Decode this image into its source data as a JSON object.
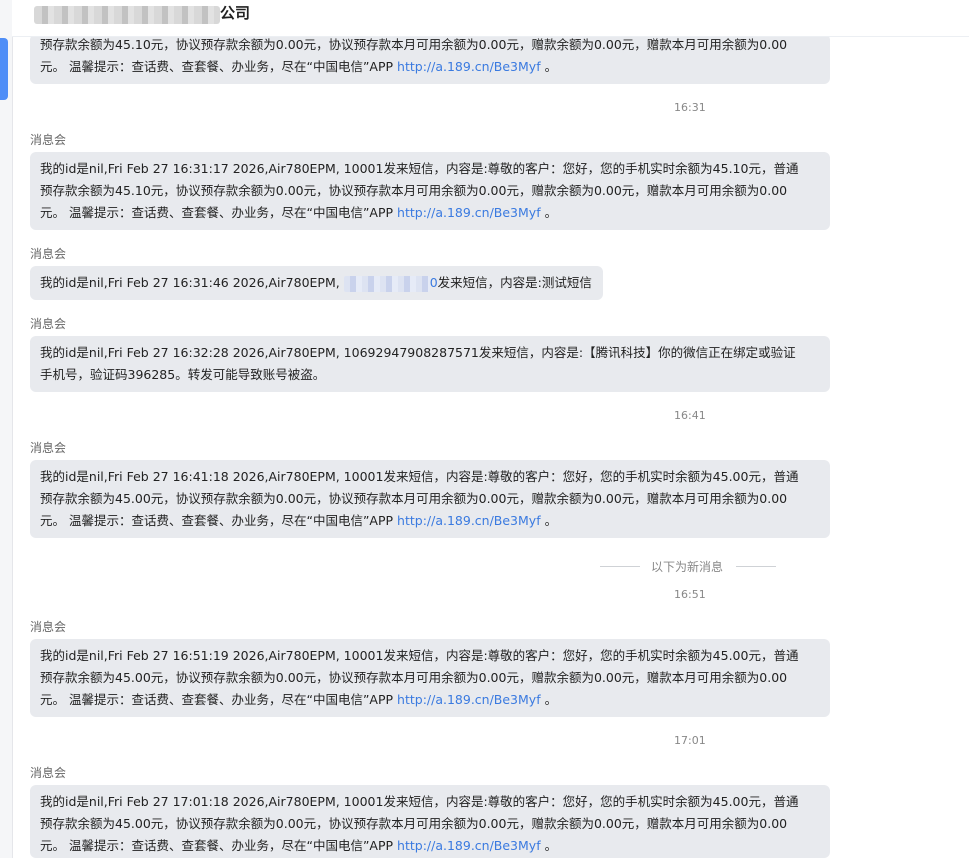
{
  "header": {
    "title": "公司"
  },
  "messages": [
    {
      "sender": "",
      "lines": [
        "预存款余额为45.10元，协议预存款余额为0.00元，协议预存款本月可用余额为0.00元，赠款余额为0.00元，赠款本月可用余额为0.00",
        "元。 温馨提示：查话费、查套餐、办业务，尽在“中国电信”APP "
      ],
      "link": "http://a.189.cn/Be3Myf",
      "tail": " 。"
    },
    {
      "sender": "消息会",
      "lines": [
        "我的id是nil,Fri Feb 27 16:31:17 2026,Air780EPM,    10001发来短信，内容是:尊敬的客户：您好，您的手机实时余额为45.10元，普通",
        "预存款余额为45.10元，协议预存款余额为0.00元，协议预存款本月可用余额为0.00元，赠款余额为0.00元，赠款本月可用余额为0.00",
        "元。 温馨提示：查话费、查套餐、办业务，尽在“中国电信”APP "
      ],
      "link": "http://a.189.cn/Be3Myf",
      "tail": " 。"
    },
    {
      "sender": "消息会",
      "prefix": "我的id是nil,Fri Feb 27 16:31:46 2026,Air780EPM,    ",
      "partial": "0",
      "suffix": "发来短信，内容是:测试短信"
    },
    {
      "sender": "消息会",
      "lines": [
        "我的id是nil,Fri Feb 27 16:32:28 2026,Air780EPM,    10692947908287571发来短信，内容是:【腾讯科技】你的微信正在绑定或验证",
        "手机号，验证码396285。转发可能导致账号被盗。"
      ]
    },
    {
      "sender": "消息会",
      "lines": [
        "我的id是nil,Fri Feb 27 16:41:18 2026,Air780EPM,    10001发来短信，内容是:尊敬的客户：您好，您的手机实时余额为45.00元，普通",
        "预存款余额为45.00元，协议预存款余额为0.00元，协议预存款本月可用余额为0.00元，赠款余额为0.00元，赠款本月可用余额为0.00",
        "元。 温馨提示：查话费、查套餐、办业务，尽在“中国电信”APP "
      ],
      "link": "http://a.189.cn/Be3Myf",
      "tail": " 。"
    },
    {
      "sender": "消息会",
      "lines": [
        "我的id是nil,Fri Feb 27 16:51:19 2026,Air780EPM,    10001发来短信，内容是:尊敬的客户：您好，您的手机实时余额为45.00元，普通",
        "预存款余额为45.00元，协议预存款余额为0.00元，协议预存款本月可用余额为0.00元，赠款余额为0.00元，赠款本月可用余额为0.00",
        "元。 温馨提示：查话费、查套餐、办业务，尽在“中国电信”APP "
      ],
      "link": "http://a.189.cn/Be3Myf",
      "tail": " 。"
    },
    {
      "sender": "消息会",
      "lines": [
        "我的id是nil,Fri Feb 27 17:01:18 2026,Air780EPM,    10001发来短信，内容是:尊敬的客户：您好，您的手机实时余额为45.00元，普通",
        "预存款余额为45.00元，协议预存款余额为0.00元，协议预存款本月可用余额为0.00元，赠款余额为0.00元，赠款本月可用余额为0.00",
        "元。 温馨提示：查话费、查套餐、办业务，尽在“中国电信”APP "
      ],
      "link": "http://a.189.cn/Be3Myf",
      "tail": " 。"
    }
  ],
  "times": [
    "16:31",
    "16:41",
    "16:51",
    "17:01"
  ],
  "divider": "以下为新消息",
  "colors": {
    "bubble": "#e8eaee",
    "link": "#3a7ae0",
    "accent": "#4f8ef7"
  }
}
